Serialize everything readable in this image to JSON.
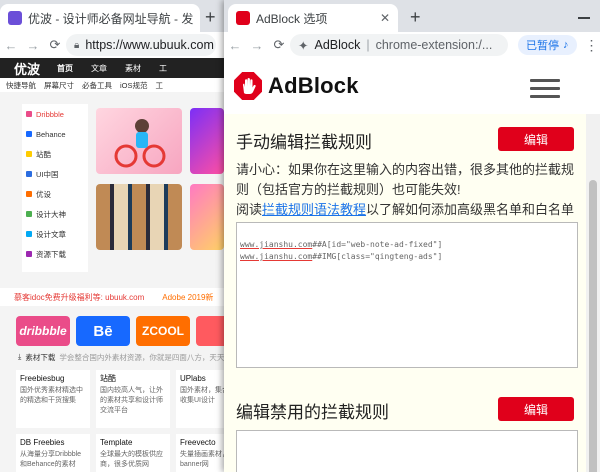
{
  "left_window": {
    "tab_title": "优波 - 设计师必备网址导航 - 发",
    "tab_favicon": "purple-u-logo",
    "url": "https://www.ubuuk.com",
    "site": {
      "logo": "优波",
      "logo_sub": "设计\nubuuk.com",
      "nav": [
        "首页",
        "文章",
        "素材",
        "工"
      ],
      "quick_links": [
        "快捷导航",
        "屏幕尺寸",
        "必备工具",
        "iOS规范",
        "工"
      ],
      "categories": [
        "Dribbble",
        "Behance",
        "站酷",
        "UI中国",
        "优设",
        "设计大神",
        "设计文章",
        "资源下载"
      ],
      "ticker": [
        "慕客idoc免费升级福利等: ubuuk.com",
        "Adobe 2019新"
      ],
      "brands": [
        {
          "label": "dribbble",
          "color": "#ea4c89"
        },
        {
          "label": "Bē",
          "color": "#1769ff"
        },
        {
          "label": "ZCOOL",
          "color": "#ff6e00"
        },
        {
          "label": "",
          "color": "#ff5a5f"
        }
      ],
      "downloads_title": "素材下载",
      "downloads_note": "学会整合国内外素材资源，你就是四面八方，天天有",
      "cards": [
        {
          "title": "Freebiesbug",
          "desc": "国外优秀素材精选中的精选和干货搜集"
        },
        {
          "title": "站酷",
          "desc": "国内较高人气，让外的素材共享和设计师交流平台"
        },
        {
          "title": "UPlabs",
          "desc": "国外素材，集合素材收集UI设计"
        },
        {
          "title": "DB Freebies",
          "desc": "从海量分享Dribbble和Behance的素材"
        },
        {
          "title": "Template",
          "desc": "全球最大的模板供应商，很多优质网"
        },
        {
          "title": "Freevecto",
          "desc": "失量插画素材，banner网"
        }
      ]
    }
  },
  "right_window": {
    "tab_title": "AdBlock 选项",
    "address_label": "AdBlock",
    "url": "chrome-extension:/...",
    "paused_label": "已暂停",
    "logo_text": "AdBlock",
    "section1": {
      "title": "手动编辑拦截规则",
      "button": "编辑",
      "warning_line1": "请小心：如果你在这里输入的内容出错，很多其他的拦截规则（包括官方的拦截规则）也可能失效!",
      "warning_prefix": "阅读",
      "warning_link": "拦截规则语法教程",
      "warning_suffix": "以了解如何添加高级黑名单和白名单规则。",
      "rules": [
        {
          "domain": "www.jianshu.com",
          "rule": "##A[id=\"web-note-ad-fixed\"]"
        },
        {
          "domain": "www.jianshu.com",
          "rule": "##IMG[class=\"qingteng-ads\"]"
        }
      ]
    },
    "section2": {
      "title": "编辑禁用的拦截规则",
      "button": "编辑"
    }
  },
  "colors": {
    "adblock_red": "#e0001b",
    "link_blue": "#1a73e8",
    "body_cream": "#fffff2"
  }
}
